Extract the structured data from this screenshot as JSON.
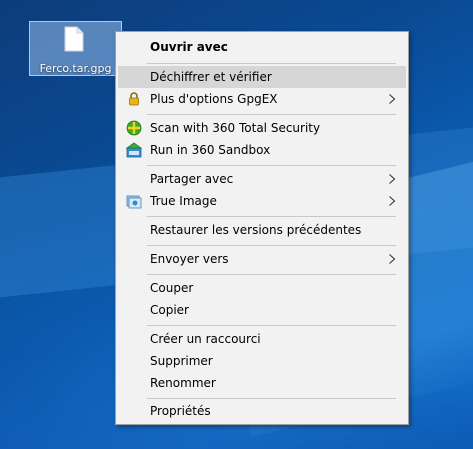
{
  "desktop": {
    "file_label": "Ferco.tar.gpg",
    "file_icon": "document-icon"
  },
  "menu": {
    "items": [
      {
        "label": "Ouvrir avec"
      },
      {
        "label": "Déchiffrer et vérifier"
      },
      {
        "label": "Plus d'options GpgEX",
        "icon": "lock-icon"
      },
      {
        "label": "Scan with 360 Total Security",
        "icon": "360-shield-icon"
      },
      {
        "label": "Run in 360 Sandbox",
        "icon": "sandbox-icon"
      },
      {
        "label": "Partager avec"
      },
      {
        "label": "True Image",
        "icon": "true-image-icon"
      },
      {
        "label": "Restaurer les versions précédentes"
      },
      {
        "label": "Envoyer vers"
      },
      {
        "label": "Couper"
      },
      {
        "label": "Copier"
      },
      {
        "label": "Créer un raccourci"
      },
      {
        "label": "Supprimer"
      },
      {
        "label": "Renommer"
      },
      {
        "label": "Propriétés"
      }
    ]
  }
}
